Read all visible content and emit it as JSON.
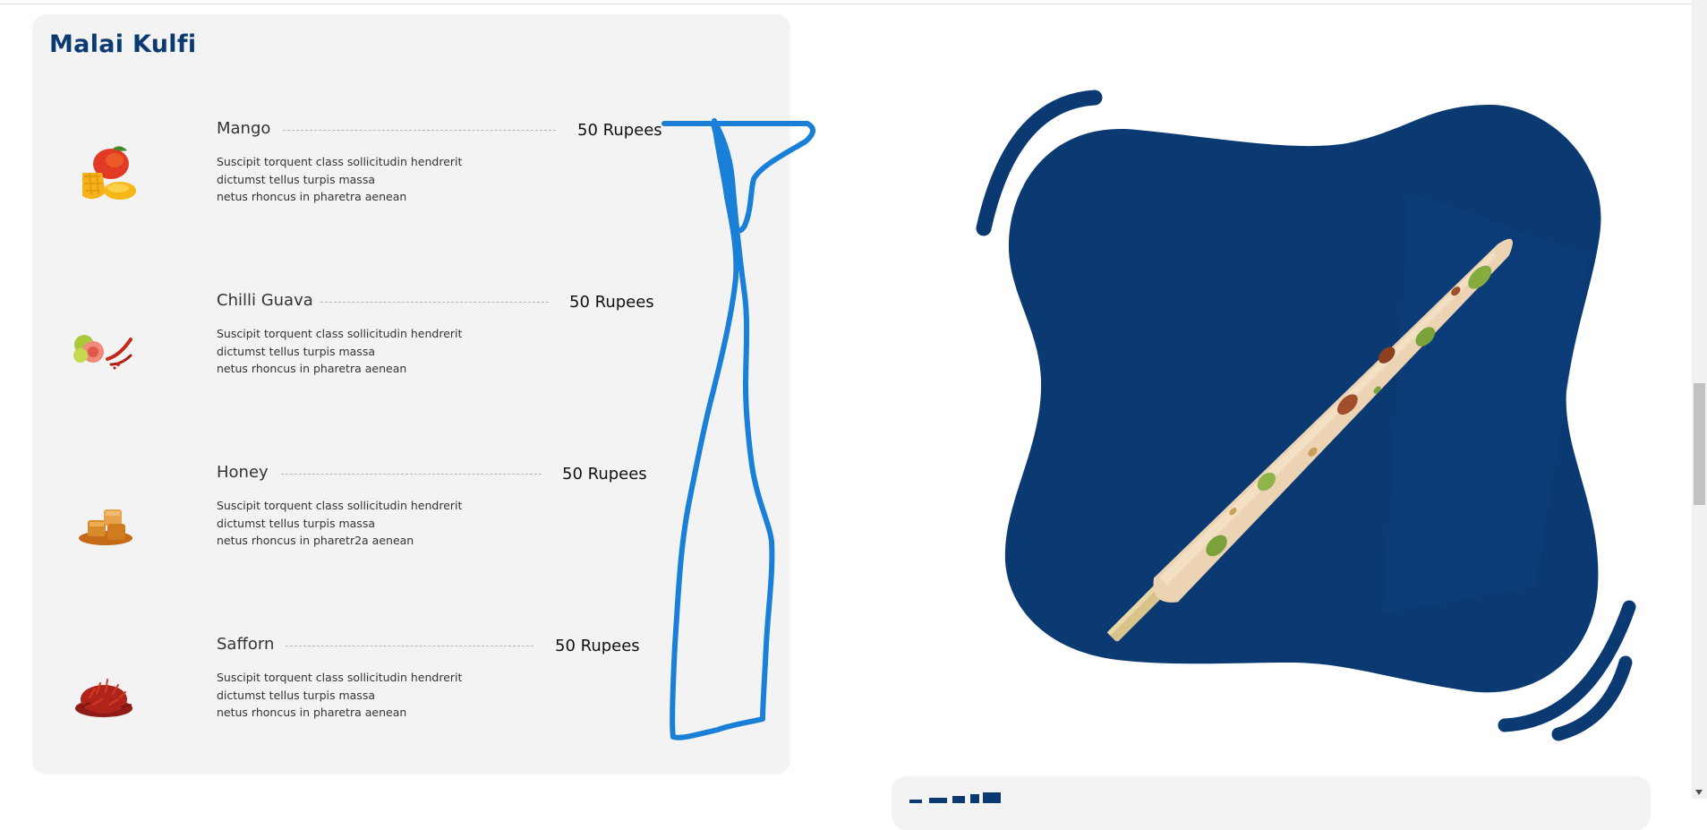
{
  "menu": {
    "title": "Malai Kulfi",
    "items": [
      {
        "name": "Mango",
        "price": "50 Rupees",
        "desc": [
          "Suscipit torquent class sollicitudin hendrerit",
          "dictumst tellus turpis massa",
          "netus rhoncus in pharetra aenean"
        ],
        "icon": "mango-icon"
      },
      {
        "name": "Chilli Guava",
        "price": "50 Rupees",
        "desc": [
          "Suscipit torquent class sollicitudin hendrerit",
          "dictumst tellus turpis massa",
          "netus rhoncus in pharetra aenean"
        ],
        "icon": "chilli-guava-icon"
      },
      {
        "name": "Honey",
        "price": "50 Rupees",
        "desc": [
          "Suscipit torquent class sollicitudin hendrerit",
          "dictumst tellus turpis massa",
          "netus rhoncus in pharetr2a aenean"
        ],
        "icon": "honey-icon"
      },
      {
        "name": "Safforn",
        "price": "50 Rupees",
        "desc": [
          "Suscipit torquent class sollicitudin hendrerit",
          "dictumst tellus turpis massa",
          "netus rhoncus in pharetra aenean"
        ],
        "icon": "saffron-icon"
      }
    ]
  },
  "colors": {
    "brand_blue": "#0b3a73",
    "card_bg": "#f3f3f4",
    "annotation_blue": "#1a7fd6",
    "kulfi_cream": "#ecd3b4",
    "pistachio": "#7ba23a"
  },
  "icons": {
    "hero": "kulfi-stick-icon",
    "annotation": "hand-drawn-stroke"
  }
}
